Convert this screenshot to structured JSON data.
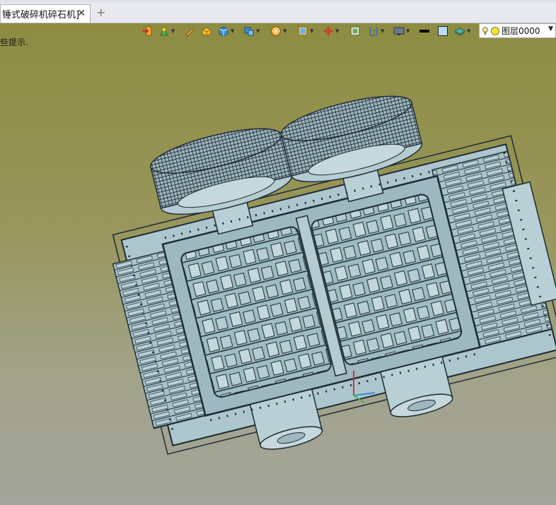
{
  "tab": {
    "title": "锤式破碎机碎石机]",
    "close_symbol": "✕",
    "add_symbol": "+"
  },
  "toolbar": {
    "icons": [
      "import-icon",
      "display-icon",
      "pen-icon",
      "box-icon",
      "solid-icon",
      "assembly-icon",
      "render-icon",
      "image-icon",
      "axis-icon",
      "view-icon",
      "section-icon",
      "monitor-icon",
      "line-color-icon",
      "fill-color-icon",
      "layer-manager-icon"
    ]
  },
  "layer": {
    "name": "图层0000"
  },
  "hint": {
    "text": "些提示."
  },
  "colors": {
    "machine": "#adc6cd",
    "edge": "#1d2b33",
    "background_top": "#8c8b3f",
    "background_bottom": "#a3a49b"
  }
}
